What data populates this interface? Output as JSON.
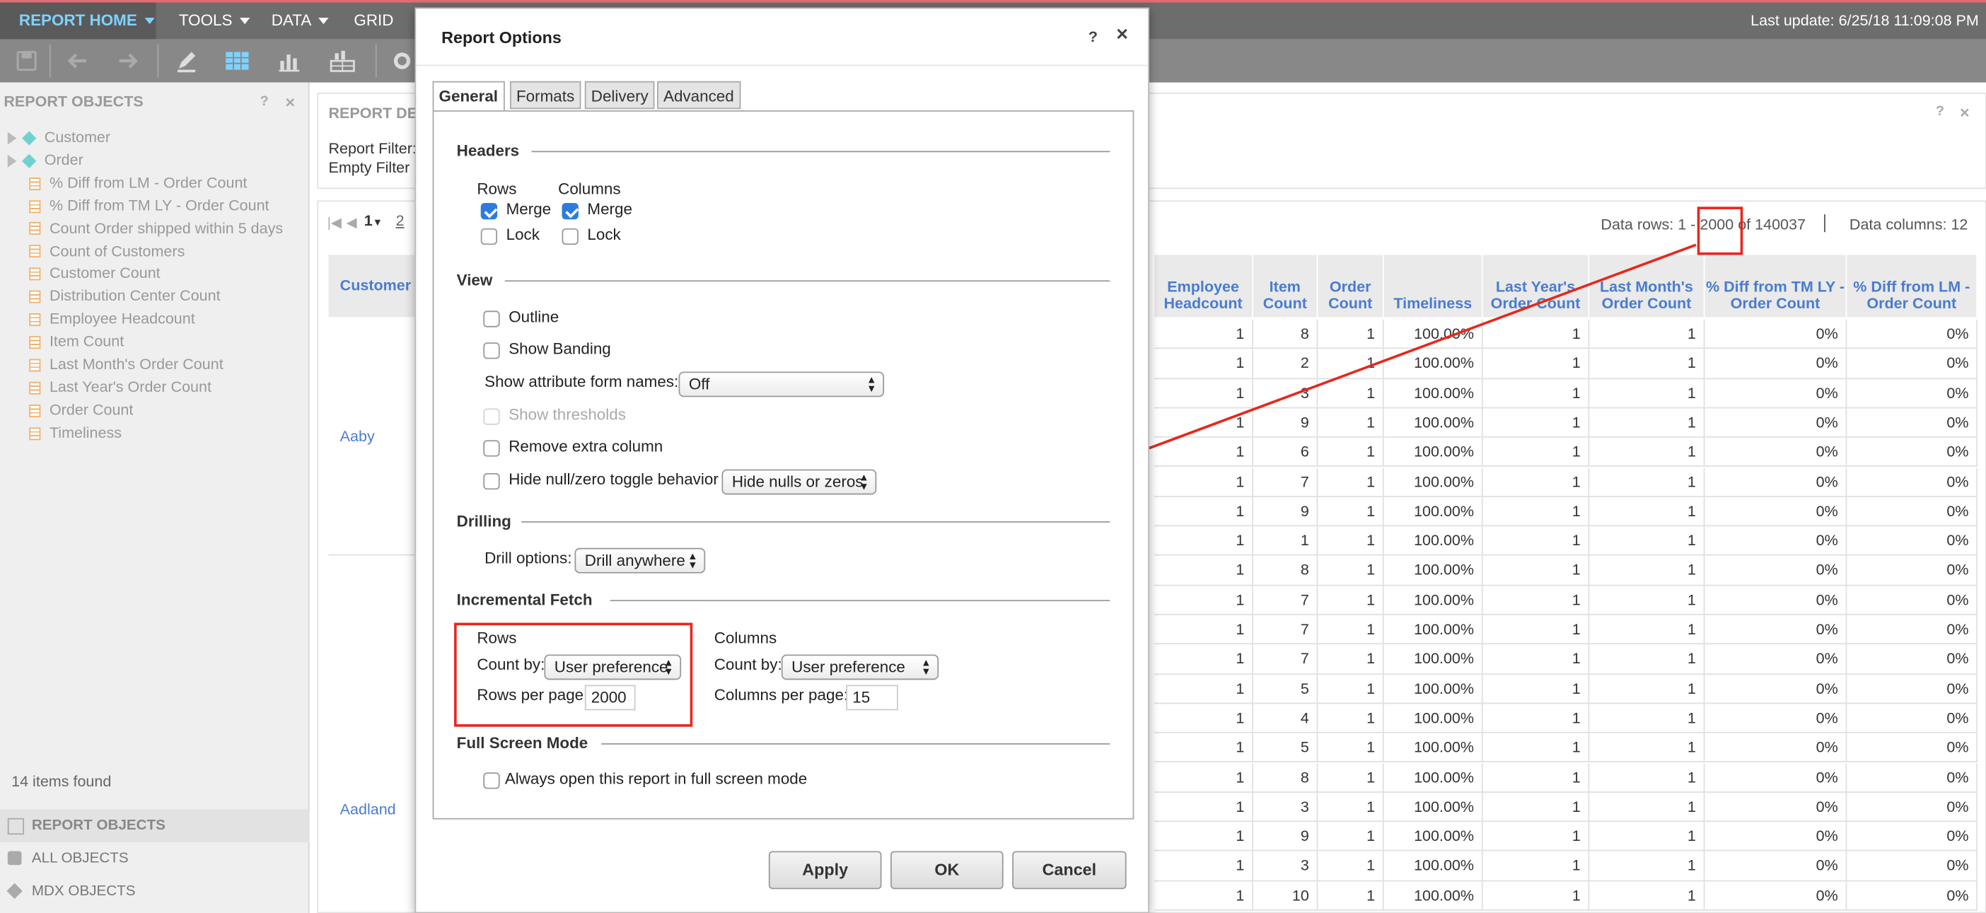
{
  "menubar": {
    "home": "REPORT HOME",
    "tools": "TOOLS",
    "data": "DATA",
    "grid": "GRID",
    "last_update": "Last update: 6/25/18 11:09:08 PM"
  },
  "left_panel": {
    "title": "REPORT OBJECTS",
    "tree": [
      {
        "label": "Customer",
        "kind": "attribute"
      },
      {
        "label": "Order",
        "kind": "attribute"
      },
      {
        "label": "% Diff from LM - Order Count",
        "kind": "metric"
      },
      {
        "label": "% Diff from TM LY - Order Count",
        "kind": "metric"
      },
      {
        "label": "Count Order shipped within 5 days",
        "kind": "metric"
      },
      {
        "label": "Count of Customers",
        "kind": "metric"
      },
      {
        "label": "Customer Count",
        "kind": "metric"
      },
      {
        "label": "Distribution Center Count",
        "kind": "metric"
      },
      {
        "label": "Employee Headcount",
        "kind": "metric"
      },
      {
        "label": "Item Count",
        "kind": "metric"
      },
      {
        "label": "Last Month's Order Count",
        "kind": "metric"
      },
      {
        "label": "Last Year's Order Count",
        "kind": "metric"
      },
      {
        "label": "Order Count",
        "kind": "metric"
      },
      {
        "label": "Timeliness",
        "kind": "metric"
      }
    ],
    "items_found": "14 items found",
    "tabs": [
      "REPORT OBJECTS",
      "ALL OBJECTS",
      "MDX OBJECTS"
    ]
  },
  "report": {
    "header_title": "REPORT DE",
    "report_filter": "Report Filter:",
    "empty_filter": "Empty Filter",
    "page_current": "1",
    "page_next": "2",
    "data_rows_prefix": "Data rows: 1 - ",
    "data_rows_hi": "2000",
    "data_rows_suffix": " of 140037",
    "data_columns": "Data columns: 12",
    "customer_header": "Customer",
    "customers": [
      "Aaby",
      "Aadland"
    ],
    "columns": [
      "Employee Headcount",
      "Item Count",
      "Order Count",
      "Timeliness",
      "Last Year's Order Count",
      "Last Month's Order Count",
      "% Diff from TM LY - Order Count",
      "% Diff from LM - Order Count"
    ],
    "rows": [
      [
        "1",
        "8",
        "1",
        "100.00%",
        "1",
        "1",
        "0%",
        "0%"
      ],
      [
        "1",
        "2",
        "1",
        "100.00%",
        "1",
        "1",
        "0%",
        "0%"
      ],
      [
        "1",
        "3",
        "1",
        "100.00%",
        "1",
        "1",
        "0%",
        "0%"
      ],
      [
        "1",
        "9",
        "1",
        "100.00%",
        "1",
        "1",
        "0%",
        "0%"
      ],
      [
        "1",
        "6",
        "1",
        "100.00%",
        "1",
        "1",
        "0%",
        "0%"
      ],
      [
        "1",
        "7",
        "1",
        "100.00%",
        "1",
        "1",
        "0%",
        "0%"
      ],
      [
        "1",
        "9",
        "1",
        "100.00%",
        "1",
        "1",
        "0%",
        "0%"
      ],
      [
        "1",
        "1",
        "1",
        "100.00%",
        "1",
        "1",
        "0%",
        "0%"
      ],
      [
        "1",
        "8",
        "1",
        "100.00%",
        "1",
        "1",
        "0%",
        "0%"
      ],
      [
        "1",
        "7",
        "1",
        "100.00%",
        "1",
        "1",
        "0%",
        "0%"
      ],
      [
        "1",
        "7",
        "1",
        "100.00%",
        "1",
        "1",
        "0%",
        "0%"
      ],
      [
        "1",
        "7",
        "1",
        "100.00%",
        "1",
        "1",
        "0%",
        "0%"
      ],
      [
        "1",
        "5",
        "1",
        "100.00%",
        "1",
        "1",
        "0%",
        "0%"
      ],
      [
        "1",
        "4",
        "1",
        "100.00%",
        "1",
        "1",
        "0%",
        "0%"
      ],
      [
        "1",
        "5",
        "1",
        "100.00%",
        "1",
        "1",
        "0%",
        "0%"
      ],
      [
        "1",
        "8",
        "1",
        "100.00%",
        "1",
        "1",
        "0%",
        "0%"
      ],
      [
        "1",
        "3",
        "1",
        "100.00%",
        "1",
        "1",
        "0%",
        "0%"
      ],
      [
        "1",
        "9",
        "1",
        "100.00%",
        "1",
        "1",
        "0%",
        "0%"
      ],
      [
        "1",
        "3",
        "1",
        "100.00%",
        "1",
        "1",
        "0%",
        "0%"
      ],
      [
        "1",
        "10",
        "1",
        "100.00%",
        "1",
        "1",
        "0%",
        "0%"
      ]
    ]
  },
  "dialog": {
    "title": "Report Options",
    "help": "?",
    "close": "×",
    "tabs": [
      "General",
      "Formats",
      "Delivery",
      "Advanced"
    ],
    "headers": {
      "title": "Headers",
      "rows_label": "Rows",
      "columns_label": "Columns",
      "merge": "Merge",
      "lock": "Lock",
      "rows_merge_checked": true,
      "rows_lock_checked": false,
      "columns_merge_checked": true,
      "columns_lock_checked": false
    },
    "view": {
      "title": "View",
      "outline": "Outline",
      "show_banding": "Show Banding",
      "attr_form_label": "Show attribute form names:",
      "attr_form_value": "Off",
      "show_thresholds": "Show thresholds",
      "remove_extra_column": "Remove extra column",
      "hide_null_label": "Hide null/zero toggle behavior",
      "hide_null_value": "Hide nulls or zeros"
    },
    "drilling": {
      "title": "Drilling",
      "drill_label": "Drill options:",
      "drill_value": "Drill anywhere"
    },
    "incremental_fetch": {
      "title": "Incremental Fetch",
      "rows_label": "Rows",
      "rows_countby_label": "Count by:",
      "rows_countby_value": "User preference",
      "rows_per_page_label": "Rows per page:",
      "rows_per_page_value": "2000",
      "columns_label": "Columns",
      "cols_countby_label": "Count by:",
      "cols_countby_value": "User preference",
      "cols_per_page_label": "Columns per page:",
      "cols_per_page_value": "15"
    },
    "full_screen": {
      "title": "Full Screen Mode",
      "always_open": "Always open this report in full screen mode"
    },
    "buttons": {
      "apply": "Apply",
      "ok": "OK",
      "cancel": "Cancel"
    }
  },
  "colors": {
    "annotation": "#e8261b",
    "accent": "#7fd2ff",
    "header_text": "#4a7ccf",
    "checkbox": "#2e7be0"
  }
}
